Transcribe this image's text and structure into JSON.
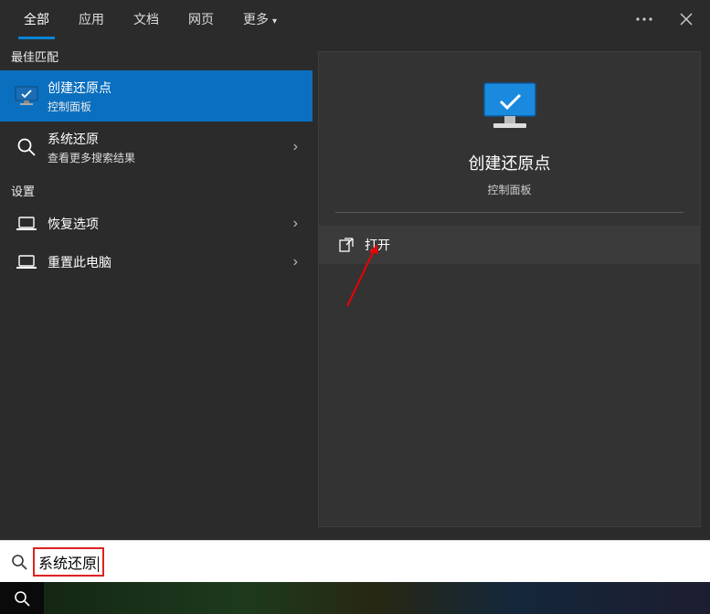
{
  "tabs": {
    "all": "全部",
    "apps": "应用",
    "docs": "文档",
    "web": "网页",
    "more": "更多"
  },
  "sections": {
    "best_match": "最佳匹配",
    "settings": "设置"
  },
  "results": {
    "r0": {
      "title": "创建还原点",
      "sub": "控制面板"
    },
    "r1": {
      "title": "系统还原",
      "sub": "查看更多搜索结果"
    }
  },
  "settings_list": {
    "s0": "恢复选项",
    "s1": "重置此电脑"
  },
  "preview": {
    "title": "创建还原点",
    "sub": "控制面板",
    "open": "打开"
  },
  "search": {
    "query": "系统还原"
  }
}
